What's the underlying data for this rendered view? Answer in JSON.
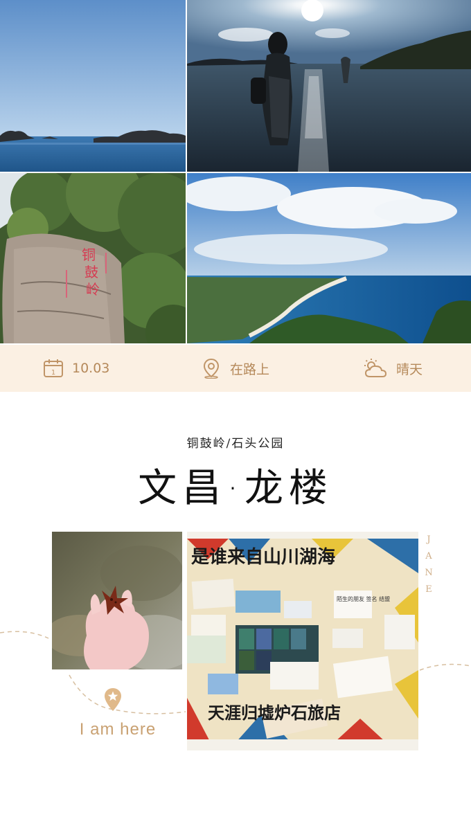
{
  "info_bar": {
    "date": "10.03",
    "location": "在路上",
    "weather": "晴天",
    "icons": [
      "calendar-icon",
      "location-pin-icon",
      "partly-cloudy-icon"
    ],
    "accent_color": "#b5895a",
    "background_color": "#fbf0e3"
  },
  "header": {
    "subtitle": "铜鼓岭/石头公园",
    "title": "文昌·龙楼"
  },
  "side_label": "JANE",
  "stamp": {
    "text": "I am here",
    "icon": "star-pin-icon",
    "color": "#c9a172"
  },
  "photos": [
    "sea-rocks-photo",
    "woman-in-water-sunset-photo",
    "carved-rock-forest-photo",
    "coastline-aerial-photo",
    "starfish-in-hand-photo",
    "postcard-wall-photo"
  ],
  "postcard_wall_text": {
    "top_line": "是谁来自山川湖海",
    "bottom_line": "天涯归墟炉石旅店",
    "note": "陌生的朋友 签名 结盟"
  }
}
